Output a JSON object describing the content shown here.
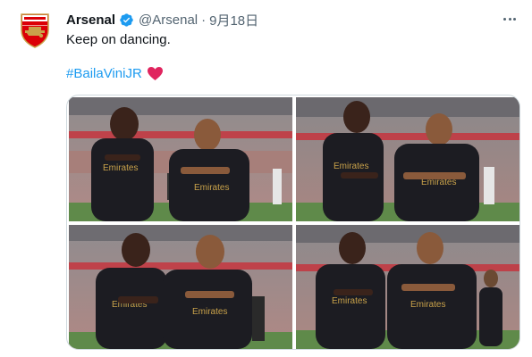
{
  "tweet": {
    "author_name": "Arsenal",
    "handle": "@Arsenal",
    "separator": "·",
    "date": "9月18日",
    "text": "Keep on dancing.",
    "hashtag": "#BailaViniJR",
    "jersey_text": "Emirates FLY BETTER"
  },
  "icons": {
    "avatar": "arsenal-crest-icon",
    "verified": "verified-badge-icon",
    "more": "more-options-icon",
    "heart": "red-heart-emoji-icon"
  },
  "colors": {
    "link": "#1d9bf0",
    "text": "#0f1419",
    "secondary": "#536471",
    "arsenal_red": "#db0007",
    "kit": "#1c1c22",
    "kit_gold": "#c9a24a"
  }
}
